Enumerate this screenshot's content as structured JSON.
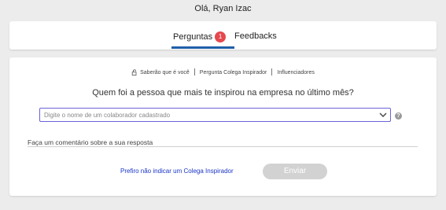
{
  "header": {
    "greeting": "Olá, Ryan Izac"
  },
  "tabs": [
    {
      "label": "Perguntas",
      "badge": "1",
      "active": true
    },
    {
      "label": "Feedbacks",
      "active": false
    }
  ],
  "breadcrumbs": {
    "items": [
      "Saberão que é você",
      "Pergunta Colega Inspirador",
      "Influenciadores"
    ]
  },
  "question": {
    "text": "Quem foi a pessoa que mais te inspirou na empresa no último mês?"
  },
  "colleague_select": {
    "placeholder": "Digite o nome de um colaborador cadastrado",
    "value": ""
  },
  "comment": {
    "placeholder": "Faça um comentário sobre a sua resposta",
    "value": ""
  },
  "actions": {
    "skip_label": "Prefiro não indicar um Colega Inspirador",
    "submit_label": "Enviar"
  },
  "colors": {
    "accent": "#1f5fa8",
    "badge": "#e5484d",
    "select_border": "#6b62d6",
    "link": "#1a34c6",
    "button_disabled": "#d2d2d2"
  }
}
